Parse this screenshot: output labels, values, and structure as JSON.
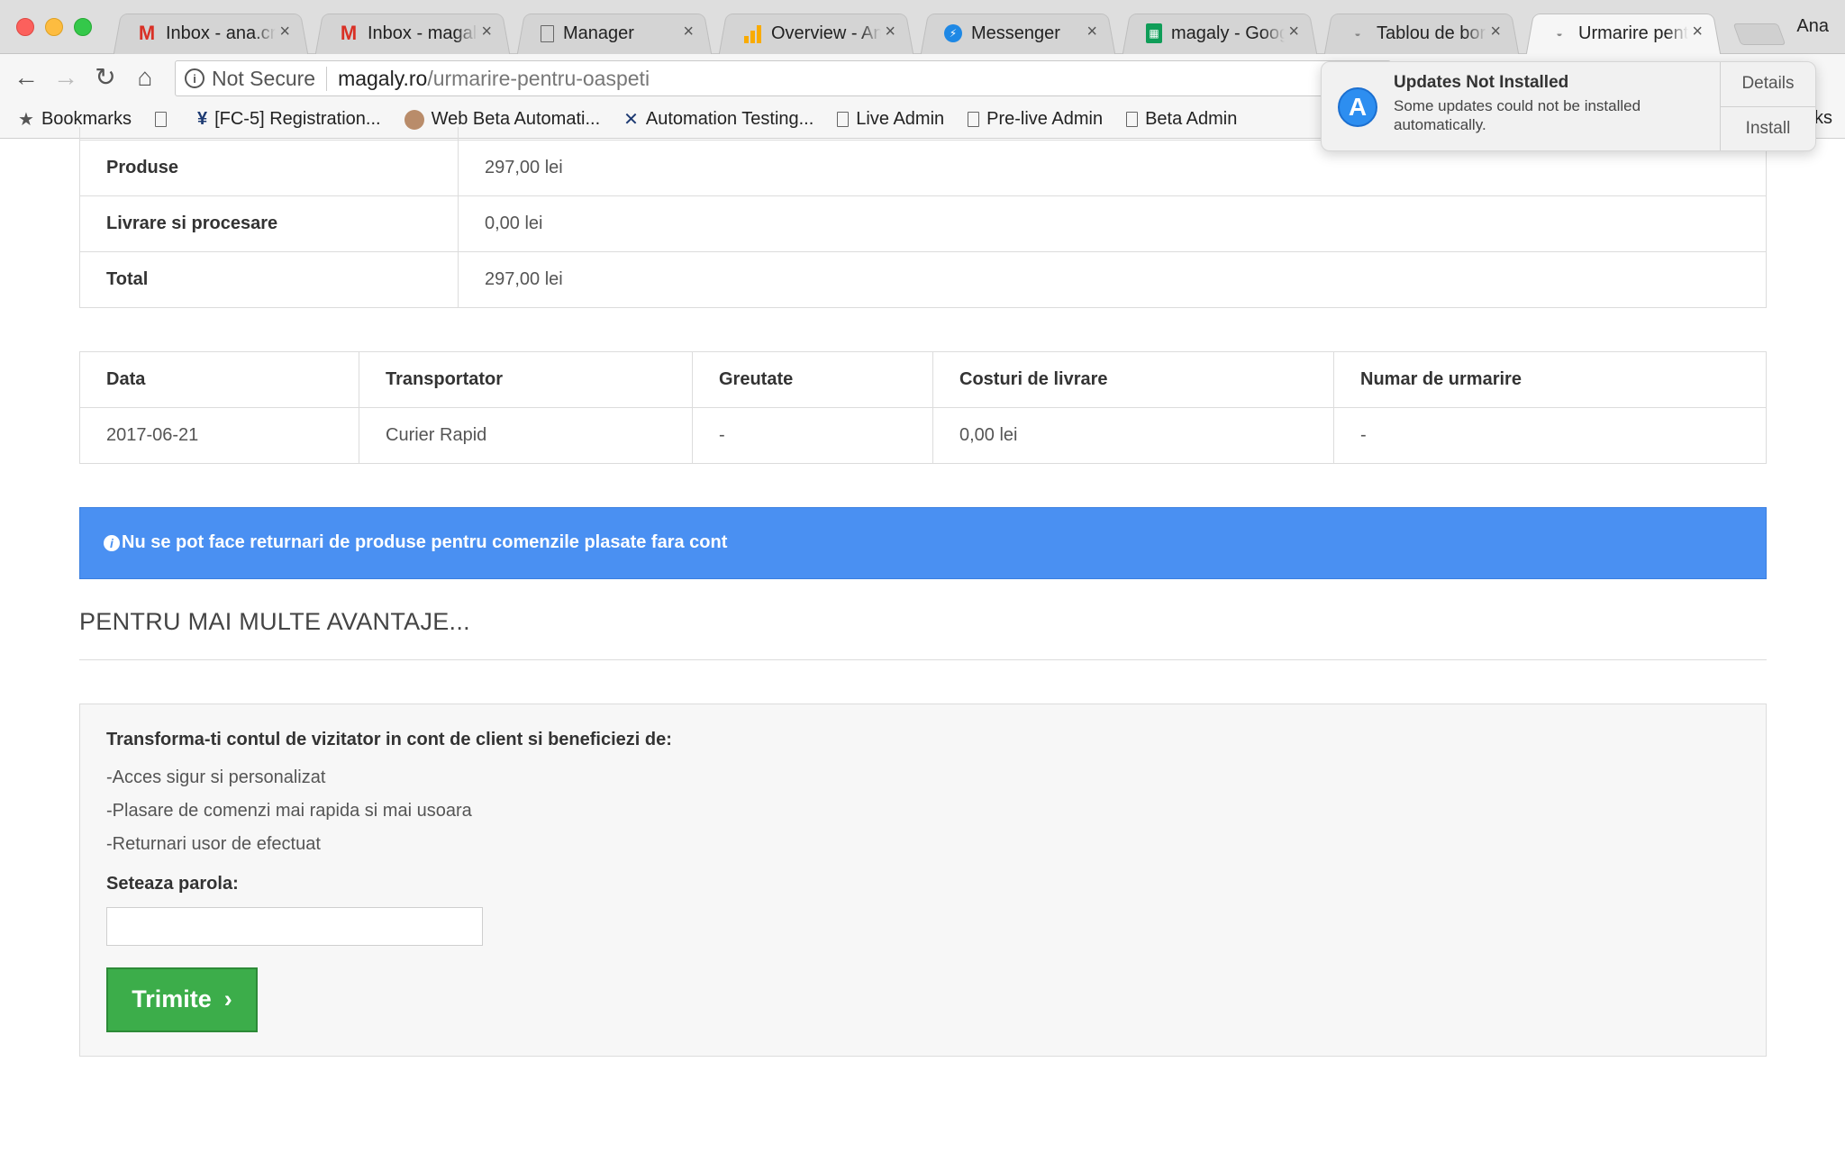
{
  "browser": {
    "tabs": [
      {
        "title": "Inbox - ana.cra",
        "icon": "gmail-icon"
      },
      {
        "title": "Inbox - magaly",
        "icon": "gmail-icon"
      },
      {
        "title": "Manager",
        "icon": "document-icon"
      },
      {
        "title": "Overview - Ana",
        "icon": "analytics-icon"
      },
      {
        "title": "Messenger",
        "icon": "messenger-icon"
      },
      {
        "title": "magaly - Googl",
        "icon": "sheets-icon"
      },
      {
        "title": "Tablou de bord",
        "icon": "site-icon"
      },
      {
        "title": "Urmarire pentru",
        "icon": "site-icon"
      }
    ],
    "profile": "Ana",
    "address": {
      "security": "Not Secure",
      "host": "magaly.ro",
      "path": "/urmarire-pentru-oaspeti"
    },
    "bookmarks": [
      {
        "label": "Bookmarks",
        "icon": "star-icon"
      },
      {
        "label": "",
        "icon": "page-icon"
      },
      {
        "label": "[FC-5] Registration...",
        "icon": "jira-icon"
      },
      {
        "label": "Web Beta Automati...",
        "icon": "avatar-icon"
      },
      {
        "label": "Automation Testing...",
        "icon": "tools-icon"
      },
      {
        "label": "Live Admin",
        "icon": "page-icon"
      },
      {
        "label": "Pre-live Admin",
        "icon": "page-icon"
      },
      {
        "label": "Beta Admin",
        "icon": "page-icon"
      }
    ],
    "bookmarks_overflow": "ks"
  },
  "notification": {
    "title": "Updates Not Installed",
    "text": "Some updates could not be installed automatically.",
    "details": "Details",
    "install": "Install"
  },
  "totals": [
    {
      "label": "Produse",
      "value": "297,00 lei"
    },
    {
      "label": "Livrare si procesare",
      "value": "0,00 lei"
    },
    {
      "label": "Total",
      "value": "297,00 lei"
    }
  ],
  "shipping": {
    "headers": [
      "Data",
      "Transportator",
      "Greutate",
      "Costuri de livrare",
      "Numar de urmarire"
    ],
    "rows": [
      [
        "2017-06-21",
        "Curier Rapid",
        "-",
        "0,00 lei",
        "-"
      ]
    ]
  },
  "alert": {
    "icon": "i",
    "text": "Nu se pot face returnari de produse pentru comenzile plasate fara cont"
  },
  "section_heading": "PENTRU MAI MULTE AVANTAJE...",
  "guest_panel": {
    "title": "Transforma-ti contul de vizitator in cont de client si beneficiezi de:",
    "benefits": [
      "-Acces sigur si personalizat",
      "-Plasare de comenzi mai rapida si mai usoara",
      "-Returnari usor de efectuat"
    ],
    "password_label": "Seteaza parola:",
    "password_value": "",
    "submit_label": "Trimite"
  },
  "colors": {
    "alert_bg": "#4a90f2",
    "submit_bg": "#3cad4a"
  }
}
